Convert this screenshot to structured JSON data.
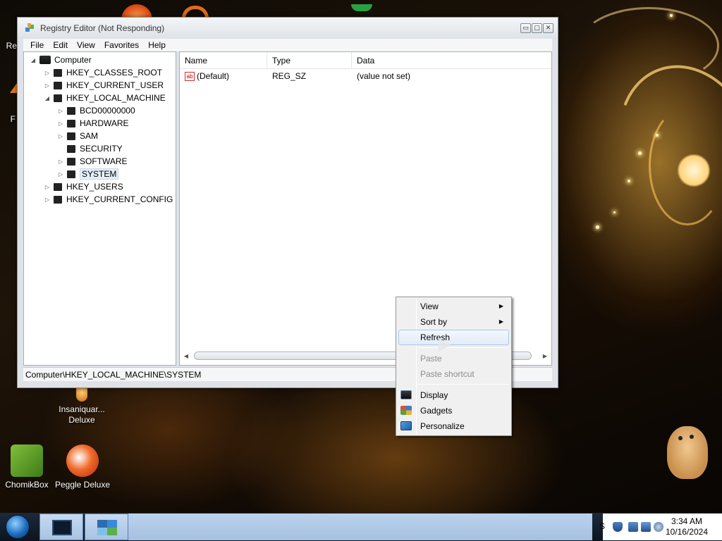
{
  "window": {
    "title": "Registry Editor (Not Responding)",
    "buttons": {
      "minimize": "▭",
      "maximize": "▢",
      "close": "✕"
    },
    "menu": [
      "File",
      "Edit",
      "View",
      "Favorites",
      "Help"
    ]
  },
  "tree": {
    "root": "Computer",
    "hives": [
      "HKEY_CLASSES_ROOT",
      "HKEY_CURRENT_USER",
      "HKEY_LOCAL_MACHINE"
    ],
    "hklm_children": [
      "BCD00000000",
      "HARDWARE",
      "SAM",
      "SECURITY",
      "SOFTWARE",
      "SYSTEM"
    ],
    "hives_after": [
      "HKEY_USERS",
      "HKEY_CURRENT_CONFIG"
    ],
    "selected": "SYSTEM"
  },
  "list": {
    "columns": [
      "Name",
      "Type",
      "Data"
    ],
    "rows": [
      {
        "name": "(Default)",
        "type": "REG_SZ",
        "data": "(value not set)",
        "icon": "ab"
      }
    ]
  },
  "status": "Computer\\HKEY_LOCAL_MACHINE\\SYSTEM",
  "context_menu": {
    "items": [
      {
        "label": "View",
        "submenu": true,
        "disabled": false
      },
      {
        "label": "Sort by",
        "submenu": true,
        "disabled": false
      },
      {
        "label": "Refresh",
        "submenu": false,
        "disabled": false,
        "hover": true
      },
      {
        "label": "Paste",
        "submenu": false,
        "disabled": true
      },
      {
        "label": "Paste shortcut",
        "submenu": false,
        "disabled": true
      },
      {
        "label": "Display",
        "submenu": false,
        "disabled": false,
        "icon": "display-icon"
      },
      {
        "label": "Gadgets",
        "submenu": false,
        "disabled": false,
        "icon": "gadgets-icon"
      },
      {
        "label": "Personalize",
        "submenu": false,
        "disabled": false,
        "icon": "personalize-icon"
      }
    ],
    "submenu_arrow": "▶"
  },
  "desktop_icons": [
    {
      "label": "Insaniquar... Deluxe"
    },
    {
      "label": "ChomikBox"
    },
    {
      "label": "Peggle Deluxe"
    }
  ],
  "desktop_partial_labels": {
    "left_top": "Re",
    "left_mid": "F"
  },
  "taskbar": {
    "clock_time": "3:34 AM",
    "clock_date": "10/16/2024",
    "tray_letter": "S"
  },
  "colors": {
    "selection": "#e5eef8",
    "menu_hover_border": "#a8c8ec",
    "taskbar_glass": "#bcd3ed"
  }
}
